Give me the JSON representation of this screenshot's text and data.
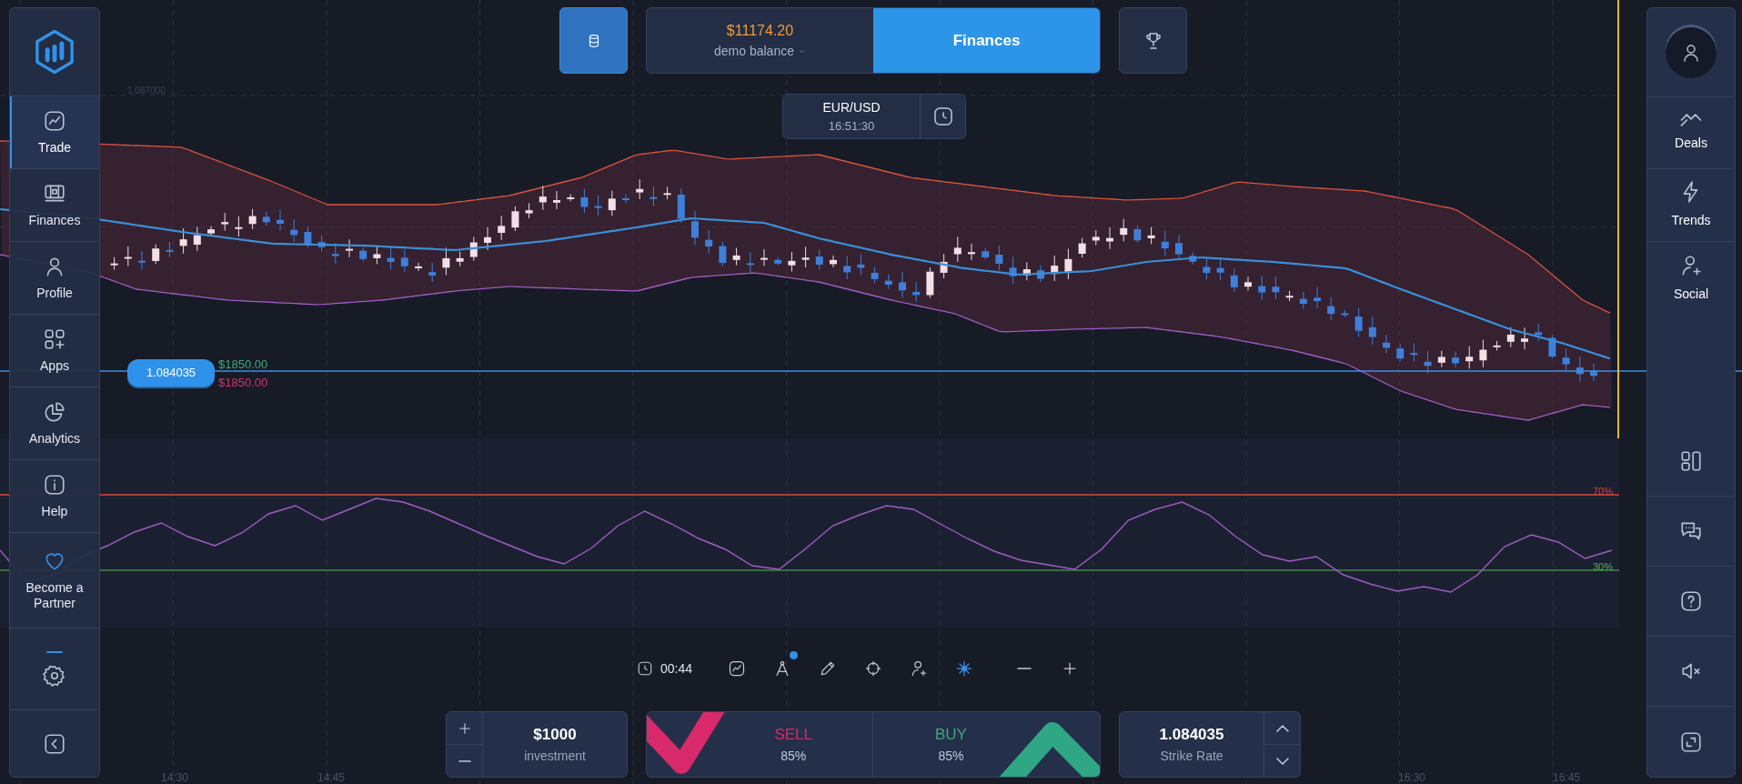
{
  "top_bar": {
    "balance": "$11174.20",
    "account": "demo balance",
    "finances_button": "Finances"
  },
  "asset": {
    "pair": "EUR/USD",
    "time": "16:51:30"
  },
  "left_sidebar": {
    "items": [
      {
        "label": "Trade",
        "selected": true
      },
      {
        "label": "Finances",
        "selected": false
      },
      {
        "label": "Profile",
        "selected": false
      },
      {
        "label": "Apps",
        "selected": false
      },
      {
        "label": "Analytics",
        "selected": false
      },
      {
        "label": "Help",
        "selected": false
      },
      {
        "label": "Become a Partner",
        "selected": false
      }
    ]
  },
  "right_sidebar": {
    "items": [
      {
        "label": "Deals"
      },
      {
        "label": "Trends"
      },
      {
        "label": "Social"
      }
    ]
  },
  "chart": {
    "price_tick": "1.087000",
    "current_price": "1.084035",
    "payout_up": "$1850.00",
    "payout_down": "$1850.00",
    "time_ticks": [
      "14:30",
      "14:45",
      "16:30",
      "16:45"
    ]
  },
  "rsi": {
    "upper_level": "70%",
    "lower_level": "30%"
  },
  "toolbar": {
    "timer": "00:44",
    "tools": [
      {
        "selected": false,
        "badge": false
      },
      {
        "selected": false,
        "badge": true
      },
      {
        "selected": false,
        "badge": false
      },
      {
        "selected": false,
        "badge": false
      },
      {
        "selected": false,
        "badge": false
      },
      {
        "selected": true,
        "badge": false
      }
    ]
  },
  "trade_panel": {
    "investment": {
      "value": "$1000",
      "label": "investment"
    },
    "sell": {
      "label": "SELL",
      "payout": "85%"
    },
    "buy": {
      "label": "BUY",
      "payout": "85%"
    },
    "strike": {
      "value": "1.084035",
      "label": "Strike Rate"
    }
  }
}
